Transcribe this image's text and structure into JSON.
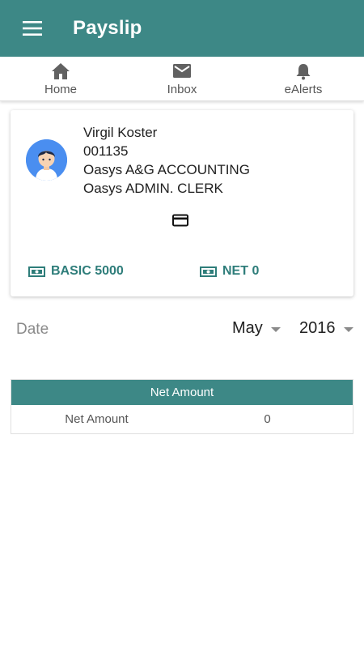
{
  "app": {
    "title": "Payslip",
    "accent_color": "#3d8886"
  },
  "tabs": [
    {
      "label": "Home",
      "icon": "home-icon"
    },
    {
      "label": "Inbox",
      "icon": "mail-icon"
    },
    {
      "label": "eAlerts",
      "icon": "bell-icon"
    }
  ],
  "employee": {
    "name": "Virgil Koster",
    "id": "001135",
    "company": "Oasys A&G ACCOUNTING",
    "position": "Oasys ADMIN. CLERK",
    "avatar_icon": "user-avatar-icon"
  },
  "card_icon": "credit-card-icon",
  "summary": {
    "basic_label": "BASIC 5000",
    "net_label": "NET 0",
    "money_icon": "money-icon"
  },
  "date": {
    "label": "Date",
    "month": "May",
    "year": "2016"
  },
  "table": {
    "header": "Net Amount",
    "rows": [
      {
        "label": "Net Amount",
        "value": "0"
      }
    ]
  }
}
